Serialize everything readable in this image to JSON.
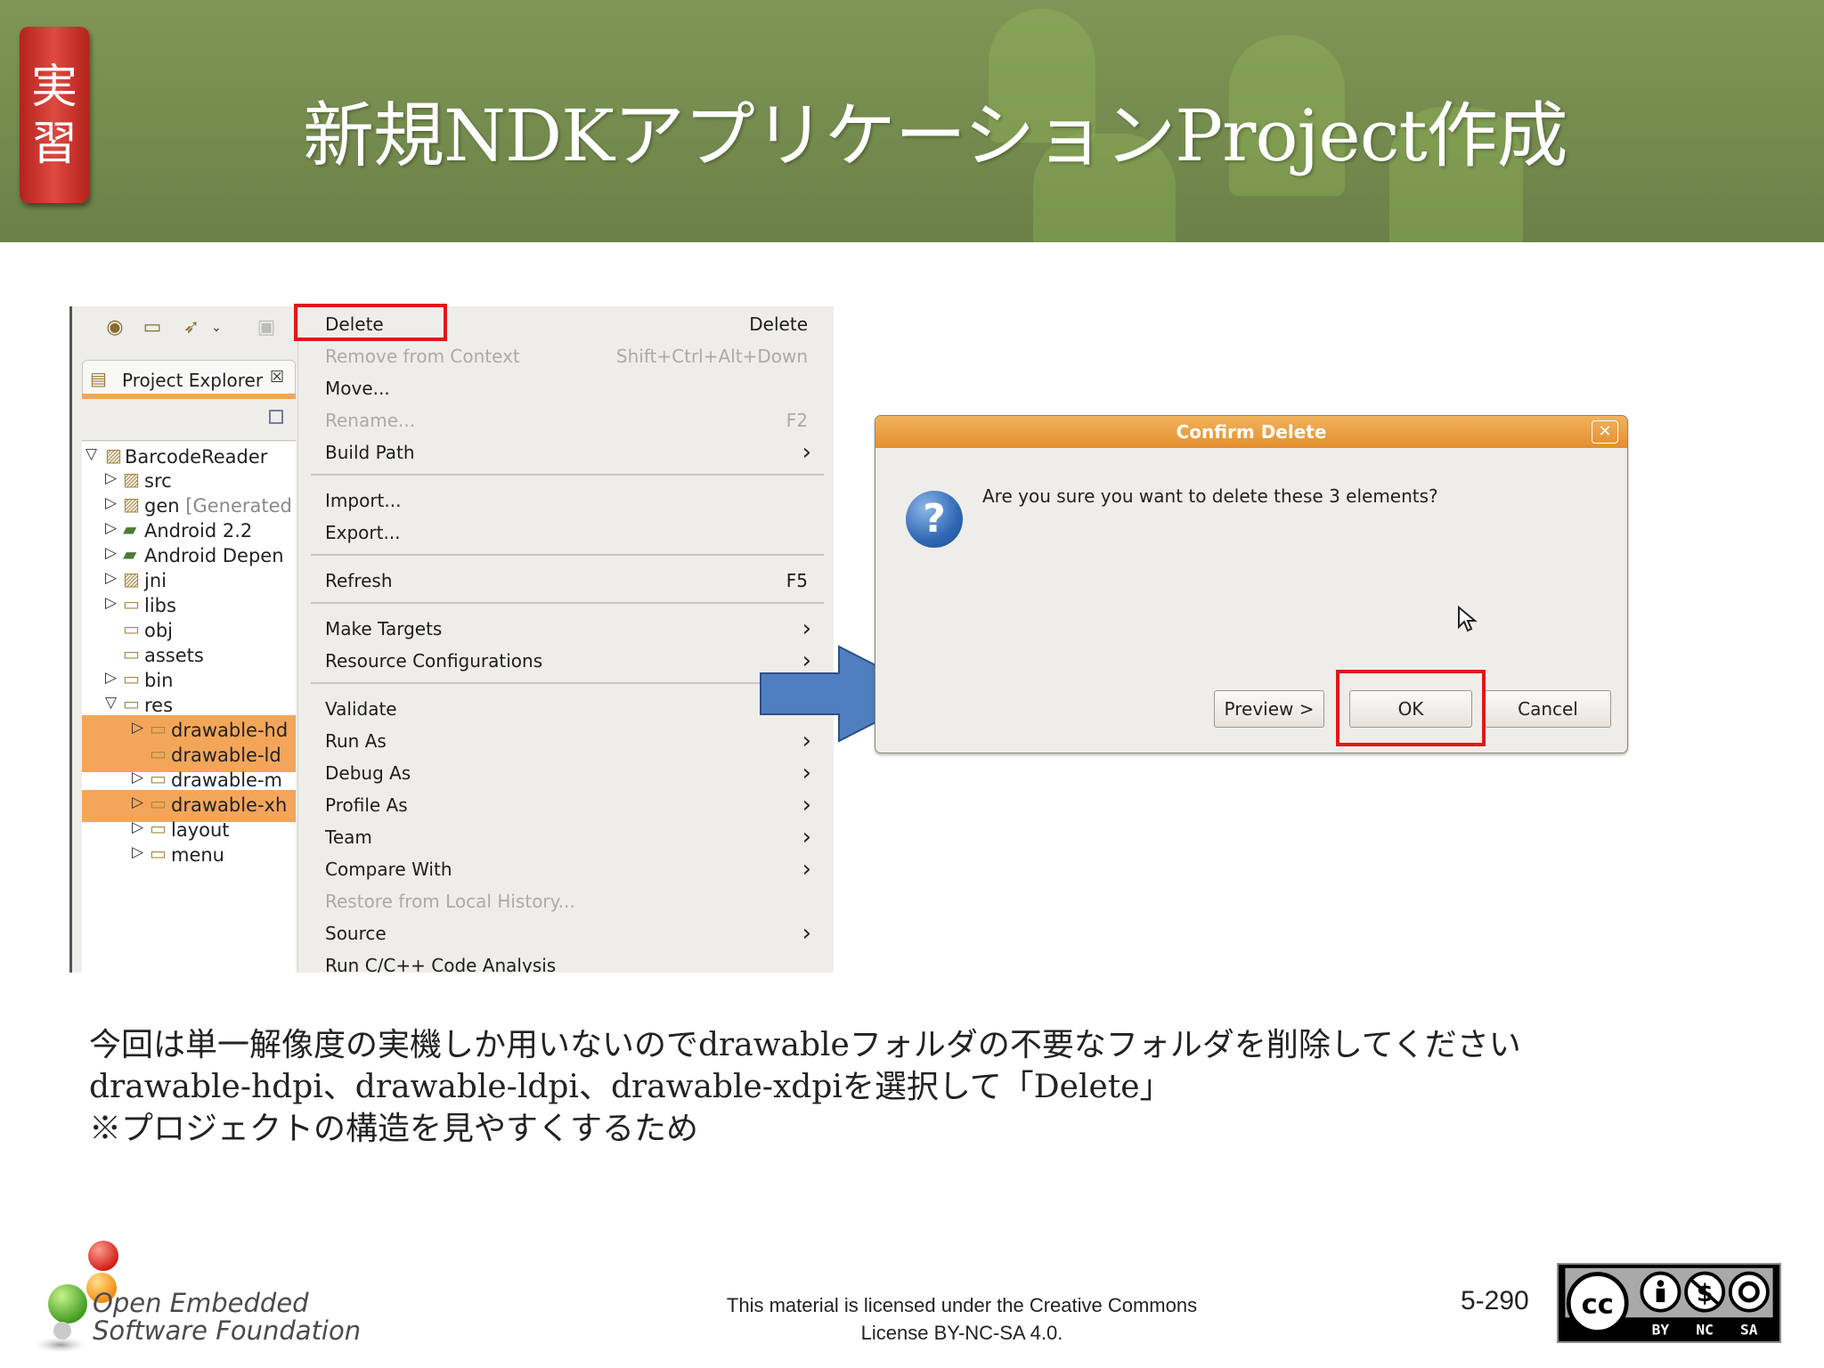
{
  "header": {
    "badge": "実習",
    "title": "新規NDKアプリケーションProject作成"
  },
  "eclipse": {
    "view_tab": "Project Explorer",
    "view_tab_close": "☒",
    "tree": [
      {
        "label": "BarcodeReader",
        "extra": "",
        "expanded": true,
        "selected": false
      },
      {
        "label": "src",
        "extra": "",
        "selected": false
      },
      {
        "label": "gen",
        "extra": "[Generated",
        "selected": false
      },
      {
        "label": "Android 2.2",
        "extra": "",
        "selected": false
      },
      {
        "label": "Android Depen",
        "extra": "",
        "selected": false
      },
      {
        "label": "jni",
        "extra": "",
        "selected": false
      },
      {
        "label": "libs",
        "extra": "",
        "selected": false
      },
      {
        "label": "obj",
        "extra": "",
        "selected": false
      },
      {
        "label": "assets",
        "extra": "",
        "selected": false
      },
      {
        "label": "bin",
        "extra": "",
        "selected": false
      },
      {
        "label": "res",
        "extra": "",
        "expanded": true,
        "selected": false
      },
      {
        "label": "drawable-hd",
        "extra": "",
        "selected": true
      },
      {
        "label": "drawable-ld",
        "extra": "",
        "selected": true
      },
      {
        "label": "drawable-m",
        "extra": "",
        "selected": false
      },
      {
        "label": "drawable-xh",
        "extra": "",
        "selected": true
      },
      {
        "label": "layout",
        "extra": "",
        "selected": false
      },
      {
        "label": "menu",
        "extra": "",
        "selected": false
      }
    ],
    "menu": [
      {
        "label": "Delete",
        "accel": "Delete",
        "disabled": false
      },
      {
        "label": "Remove from Context",
        "accel": "Shift+Ctrl+Alt+Down",
        "disabled": true
      },
      {
        "label": "Move...",
        "accel": "",
        "disabled": false
      },
      {
        "label": "Rename...",
        "accel": "F2",
        "disabled": true
      },
      {
        "label": "Build Path",
        "accel": "",
        "submenu": true,
        "disabled": false
      },
      {
        "label": "Import...",
        "accel": "",
        "disabled": false
      },
      {
        "label": "Export...",
        "accel": "",
        "disabled": false
      },
      {
        "label": "Refresh",
        "accel": "F5",
        "disabled": false
      },
      {
        "label": "Make Targets",
        "accel": "",
        "submenu": true,
        "disabled": false
      },
      {
        "label": "Resource Configurations",
        "accel": "",
        "submenu": true,
        "disabled": false
      },
      {
        "label": "Validate",
        "accel": "",
        "disabled": false
      },
      {
        "label": "Run As",
        "accel": "",
        "submenu": true,
        "disabled": false
      },
      {
        "label": "Debug As",
        "accel": "",
        "submenu": true,
        "disabled": false
      },
      {
        "label": "Profile As",
        "accel": "",
        "submenu": true,
        "disabled": false
      },
      {
        "label": "Team",
        "accel": "",
        "submenu": true,
        "disabled": false
      },
      {
        "label": "Compare With",
        "accel": "",
        "submenu": true,
        "disabled": false
      },
      {
        "label": "Restore from Local History...",
        "accel": "",
        "disabled": true
      },
      {
        "label": "Source",
        "accel": "",
        "submenu": true,
        "disabled": false
      },
      {
        "label": "Run C/C++ Code Analysis",
        "accel": "",
        "disabled": false
      }
    ]
  },
  "dialog": {
    "title": "Confirm Delete",
    "close": "✕",
    "message": "Are you sure you want to delete these 3 elements?",
    "buttons": {
      "preview": "Preview >",
      "ok": "OK",
      "cancel": "Cancel"
    }
  },
  "body": {
    "line1": "今回は単一解像度の実機しか用いないのでdrawableフォルダの不要なフォルダを削除してください",
    "line2": "drawable-hdpi、drawable-ldpi、drawable-xdpiを選択して「Delete」",
    "line3": "※プロジェクトの構造を見やすくするため"
  },
  "footer": {
    "org_line1": "Open Embedded",
    "org_line2": "Software Foundation",
    "license_line1": "This material is licensed under the Creative Commons",
    "license_line2": "License BY-NC-SA 4.0.",
    "page": "5-290",
    "cc_labels": [
      "BY",
      "NC",
      "SA"
    ]
  },
  "colors": {
    "accent_orange": "#f3a65a",
    "highlight_red": "#e01818",
    "arrow_blue": "#4f7fc0"
  }
}
